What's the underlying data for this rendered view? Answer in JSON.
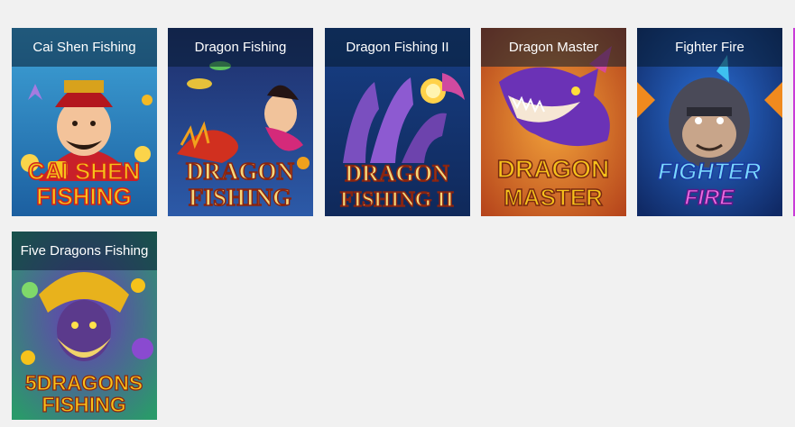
{
  "games": [
    {
      "title": "Cai Shen Fishing",
      "logo_line1": "CAI SHEN",
      "logo_line2": "FISHING",
      "icon": "cai-shen-character"
    },
    {
      "title": "Dragon Fishing",
      "logo_line1": "DRAGON",
      "logo_line2": "FISHING",
      "icon": "mermaid-and-dragon"
    },
    {
      "title": "Dragon Fishing II",
      "logo_line1": "DRAGON",
      "logo_line2": "FISHING II",
      "icon": "purple-hydra-dragon"
    },
    {
      "title": "Dragon Master",
      "logo_line1": "DRAGON",
      "logo_line2": "MASTER",
      "icon": "purple-dragon-head"
    },
    {
      "title": "Fighter Fire",
      "logo_line1": "FIGHTER",
      "logo_line2": "FIRE",
      "icon": "gorilla-fighter"
    },
    {
      "title": "Five Dragons Fishing",
      "logo_line1": "5DRAGONS",
      "logo_line2": "FISHING",
      "icon": "golden-dragon-warrior"
    }
  ],
  "colors": {
    "page_bg": "#f1f1f1",
    "caption_bg": "#0c2438",
    "caption_text": "#ffffff",
    "logo_gold": "#f6c21b",
    "logo_red": "#d2231b"
  }
}
